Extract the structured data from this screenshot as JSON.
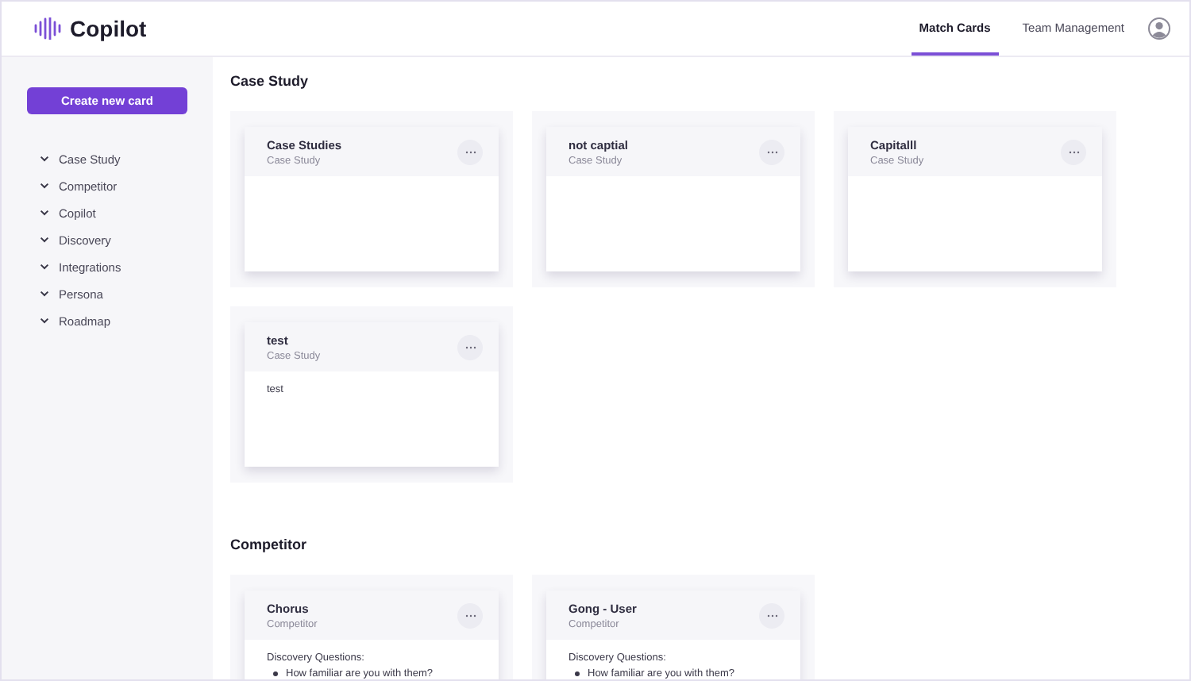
{
  "brand": {
    "name": "Copilot"
  },
  "nav": [
    {
      "label": "Match Cards",
      "selected": true
    },
    {
      "label": "Team Management",
      "selected": false
    }
  ],
  "sidebar": {
    "button": "Create new card",
    "items": [
      {
        "label": "Case Study",
        "expanded": false
      },
      {
        "label": "Competitor",
        "expanded": false
      },
      {
        "label": "Copilot",
        "expanded": false
      },
      {
        "label": "Discovery",
        "expanded": false
      },
      {
        "label": "Integrations",
        "expanded": false
      },
      {
        "label": "Persona",
        "expanded": false
      },
      {
        "label": "Roadmap",
        "expanded": false
      }
    ]
  },
  "sections": [
    {
      "title": "Case Study",
      "cards": [
        {
          "title": "Case Studies",
          "category": "Case Study"
        },
        {
          "title": "not captial",
          "category": "Case Study"
        },
        {
          "title": "Capitalll",
          "category": "Case Study"
        },
        {
          "title": "test",
          "category": "Case Study",
          "body": "test"
        }
      ]
    },
    {
      "title": "Competitor",
      "cards": [
        {
          "title": "Chorus",
          "category": "Competitor",
          "body": "Discovery Questions:",
          "bullets": [
            "How familiar are you with them?"
          ]
        },
        {
          "title": "Gong - User",
          "category": "Competitor",
          "body": "Discovery Questions:",
          "bullets": [
            "How familiar are you with them?"
          ]
        }
      ]
    }
  ]
}
